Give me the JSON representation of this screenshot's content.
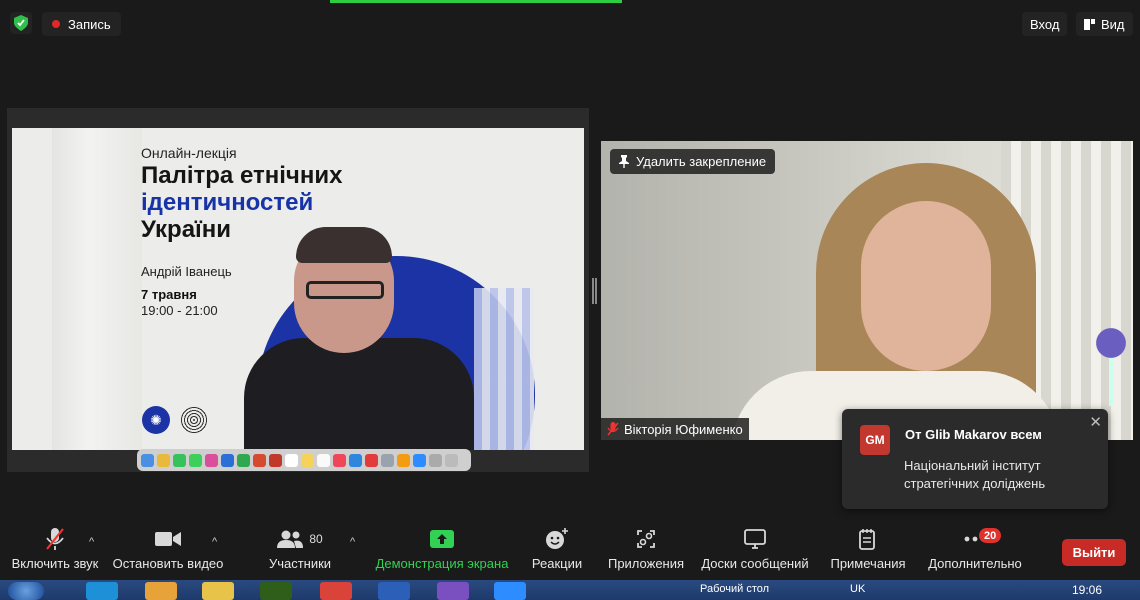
{
  "topbar": {
    "record_label": "Запись",
    "signin_label": "Вход",
    "view_label": "Вид"
  },
  "slide": {
    "subtitle": "Онлайн-лекція",
    "title_line1": "Палітра етнічних",
    "title_line2": "ідентичностей",
    "title_line3": "України",
    "author": "Андрій Іванець",
    "date": "7 травня",
    "time": "19:00 - 21:00"
  },
  "video": {
    "unpin_label": "Удалить закрепление",
    "participant_name": "Вікторія Юфименко"
  },
  "chat": {
    "avatar_initials": "GM",
    "from": "От Glib Makarov всем",
    "message": "Національний інститут стратегічних доліджень"
  },
  "toolbar": {
    "unmute_label": "Включить звук",
    "stop_video_label": "Остановить видео",
    "participants_label": "Участники",
    "participants_count": "80",
    "share_label": "Демонстрация экрана",
    "reactions_label": "Реакции",
    "apps_label": "Приложения",
    "whiteboards_label": "Доски сообщений",
    "notes_label": "Примечания",
    "more_label": "Дополнительно",
    "more_badge": "20",
    "leave_label": "Выйти"
  },
  "taskbar": {
    "desktop_label": "Рабочий стол",
    "lang": "UK",
    "clock": "19:06"
  },
  "colors": {
    "accent_green": "#33d153",
    "leave_red": "#c82a25",
    "slide_blue": "#1c33a6"
  }
}
